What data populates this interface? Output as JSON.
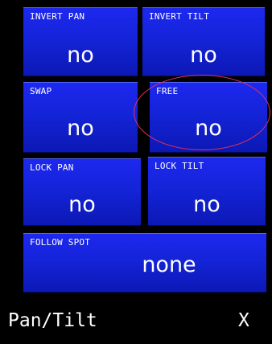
{
  "tiles": [
    {
      "label": "INVERT PAN",
      "value": "no"
    },
    {
      "label": "INVERT TILT",
      "value": "no"
    },
    {
      "label": "SWAP",
      "value": "no"
    },
    {
      "label": "FREE",
      "value": "no"
    },
    {
      "label": "LOCK PAN",
      "value": "no"
    },
    {
      "label": "LOCK TILT",
      "value": "no"
    },
    {
      "label": "FOLLOW SPOT",
      "value": "none"
    }
  ],
  "footer": {
    "title": "Pan/Tilt",
    "close_label": "X"
  },
  "colors": {
    "tile_blue": "#1424d8",
    "background": "#000000",
    "highlight": "#e0305a"
  }
}
